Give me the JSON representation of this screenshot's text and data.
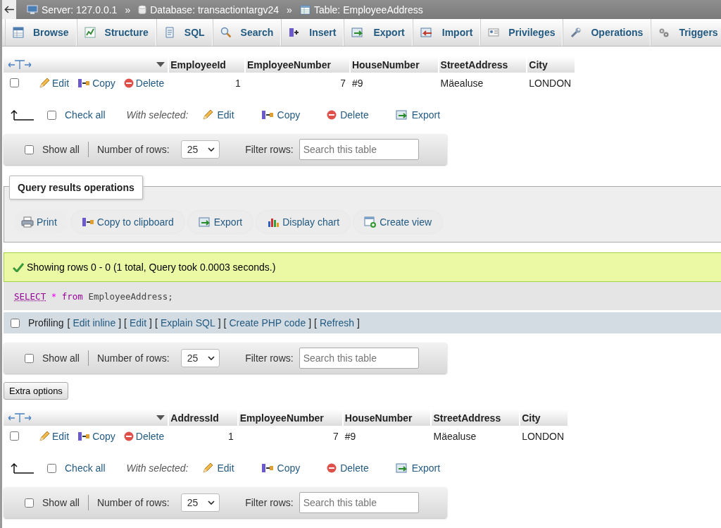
{
  "breadcrumb": [
    {
      "label": "Server: 127.0.0.1",
      "kind": "server"
    },
    {
      "label": "Database: transactiontargv24",
      "kind": "database"
    },
    {
      "label": "Table: EmployeeAddress",
      "kind": "table"
    }
  ],
  "breadcrumb_separator": "»",
  "tabs": [
    {
      "label": "Browse",
      "kind": "browse"
    },
    {
      "label": "Structure",
      "kind": "structure"
    },
    {
      "label": "SQL",
      "kind": "sql"
    },
    {
      "label": "Search",
      "kind": "search"
    },
    {
      "label": "Insert",
      "kind": "insert"
    },
    {
      "label": "Export",
      "kind": "export"
    },
    {
      "label": "Import",
      "kind": "import"
    },
    {
      "label": "Privileges",
      "kind": "privileges"
    },
    {
      "label": "Operations",
      "kind": "operations"
    },
    {
      "label": "Triggers",
      "kind": "triggers"
    }
  ],
  "first_result": {
    "columns": [
      {
        "label": "EmployeeId",
        "kind": "number"
      },
      {
        "label": "EmployeeNumber",
        "kind": "number"
      },
      {
        "label": "HouseNumber",
        "kind": "text"
      },
      {
        "label": "StreetAddress",
        "kind": "text"
      },
      {
        "label": "City",
        "kind": "text"
      }
    ],
    "rows": [
      {
        "checked": false,
        "actions": [
          {
            "label": "Edit",
            "kind": "edit"
          },
          {
            "label": "Copy",
            "kind": "copy"
          },
          {
            "label": "Delete",
            "kind": "delete"
          }
        ],
        "cells": [
          "1",
          "7",
          "#9",
          "Mäealuse",
          "LONDON"
        ]
      }
    ],
    "check_all": {
      "label": "Check all",
      "checked": false
    },
    "with_selected": "With selected:",
    "bulk_actions": [
      {
        "label": "Edit",
        "kind": "edit"
      },
      {
        "label": "Copy",
        "kind": "copy"
      },
      {
        "label": "Delete",
        "kind": "delete"
      },
      {
        "label": "Export",
        "kind": "export"
      }
    ],
    "navigation": {
      "show_all": {
        "label": "Show all",
        "checked": false
      },
      "rows_label": "Number of rows:",
      "rows_value": "25",
      "filter_label": "Filter rows:",
      "filter_placeholder": "Search this table"
    }
  },
  "query_results_operations": {
    "title": "Query results operations",
    "buttons": [
      {
        "label": "Print",
        "kind": "print"
      },
      {
        "label": "Copy to clipboard",
        "kind": "copy"
      },
      {
        "label": "Export",
        "kind": "export"
      },
      {
        "label": "Display chart",
        "kind": "chart"
      },
      {
        "label": "Create view",
        "kind": "view"
      }
    ]
  },
  "message": "Showing rows 0 - 0 (1 total, Query took 0.0003 seconds.)",
  "sql_query": [
    {
      "text": "SELECT",
      "kind": "keyword_link"
    },
    {
      "text": "*",
      "kind": "operator"
    },
    {
      "text": "from",
      "kind": "keyword"
    },
    {
      "text": "EmployeeAddress;",
      "kind": "plain"
    }
  ],
  "profiling": {
    "label": "Profiling",
    "checked": false,
    "bracket_open": "[",
    "bracket_close": "]",
    "links": [
      "Edit inline",
      "Edit",
      "Explain SQL",
      "Create PHP code",
      "Refresh"
    ]
  },
  "navigation": {
    "show_all": {
      "label": "Show all",
      "checked": false
    },
    "rows_label": "Number of rows:",
    "rows_value": "25",
    "filter_label": "Filter rows:",
    "filter_placeholder": "Search this table"
  },
  "extra_options_button": "Extra options",
  "second_result": {
    "columns": [
      {
        "label": "AddressId",
        "kind": "number"
      },
      {
        "label": "EmployeeNumber",
        "kind": "number"
      },
      {
        "label": "HouseNumber",
        "kind": "text"
      },
      {
        "label": "StreetAddress",
        "kind": "text"
      },
      {
        "label": "City",
        "kind": "text"
      }
    ],
    "rows": [
      {
        "checked": false,
        "actions": [
          {
            "label": "Edit",
            "kind": "edit"
          },
          {
            "label": "Copy",
            "kind": "copy"
          },
          {
            "label": "Delete",
            "kind": "delete"
          }
        ],
        "cells": [
          "1",
          "7",
          "#9",
          "Mäealuse",
          "LONDON"
        ]
      }
    ],
    "check_all": {
      "label": "Check all",
      "checked": false
    },
    "with_selected": "With selected:",
    "bulk_actions": [
      {
        "label": "Edit",
        "kind": "edit"
      },
      {
        "label": "Copy",
        "kind": "copy"
      },
      {
        "label": "Delete",
        "kind": "delete"
      },
      {
        "label": "Export",
        "kind": "export"
      }
    ],
    "navigation": {
      "show_all": {
        "label": "Show all",
        "checked": false
      },
      "rows_label": "Number of rows:",
      "rows_value": "25",
      "filter_label": "Filter rows:",
      "filter_placeholder": "Search this table"
    }
  }
}
